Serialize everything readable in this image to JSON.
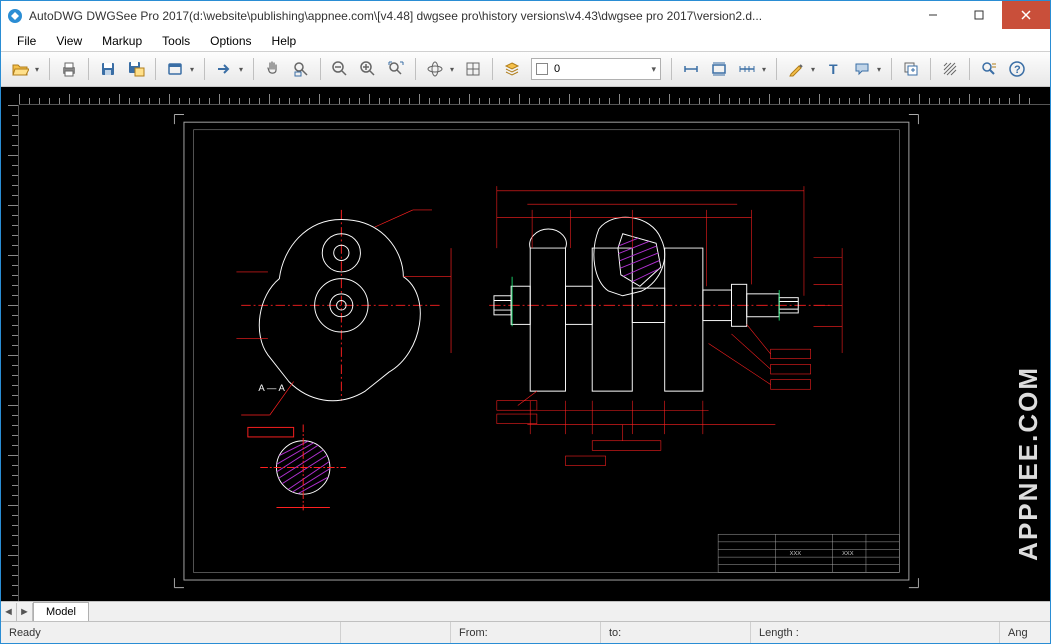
{
  "window": {
    "title": "AutoDWG DWGSee Pro 2017(d:\\website\\publishing\\appnee.com\\[v4.48] dwgsee pro\\history versions\\v4.43\\dwgsee pro 2017\\version2.d...",
    "minimize": "–",
    "maximize": "▢",
    "close": "✕"
  },
  "menu": {
    "file": "File",
    "view": "View",
    "markup": "Markup",
    "tools": "Tools",
    "options": "Options",
    "help": "Help"
  },
  "toolbar": {
    "layer_value": "0"
  },
  "tabs": {
    "model": "Model"
  },
  "status": {
    "ready": "Ready",
    "from": "From:",
    "to": "to:",
    "length": "Length :",
    "ang": "Ang"
  },
  "drawing": {
    "section_label": "A — A",
    "titleblock_name": "XXX",
    "titleblock_name2": "XXX"
  },
  "watermark": "APPNEE.COM"
}
